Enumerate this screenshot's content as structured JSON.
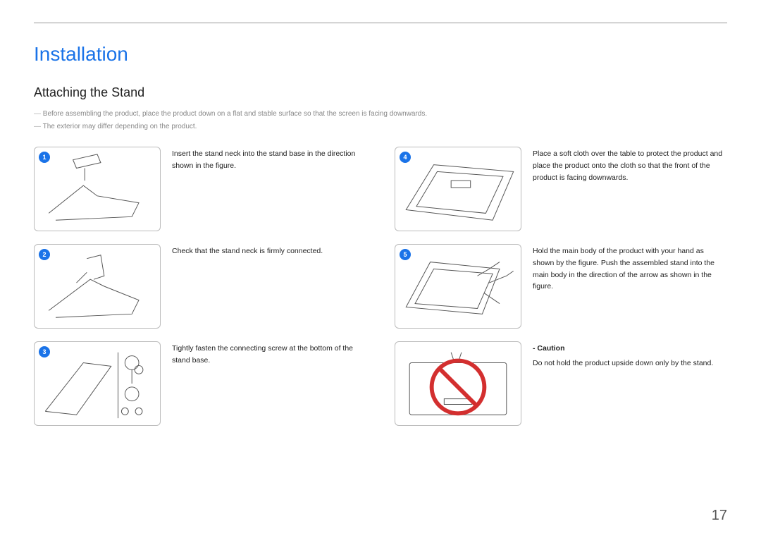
{
  "header": {
    "title": "Installation",
    "subtitle": "Attaching the Stand"
  },
  "notes": [
    "Before assembling the product, place the product down on a flat and stable surface so that the screen is facing downwards.",
    "The exterior may differ depending on the product."
  ],
  "left_steps": [
    {
      "num": "1",
      "text": "Insert the stand neck into the stand base in the direction shown in the figure."
    },
    {
      "num": "2",
      "text": "Check that the stand neck is firmly connected."
    },
    {
      "num": "3",
      "text": "Tightly fasten the connecting screw at the bottom of the stand base."
    }
  ],
  "right_steps": [
    {
      "num": "4",
      "text": "Place a soft cloth over the table to protect the product and place the product onto the cloth so that the front of the product is facing downwards."
    },
    {
      "num": "5",
      "text": "Hold the main body of the product with your hand as shown by the figure. Push the assembled stand into the main body in the direction of the arrow as shown in the figure."
    }
  ],
  "caution": {
    "label": "- Caution",
    "text": "Do not hold the product upside down only by the stand."
  },
  "page_number": "17"
}
